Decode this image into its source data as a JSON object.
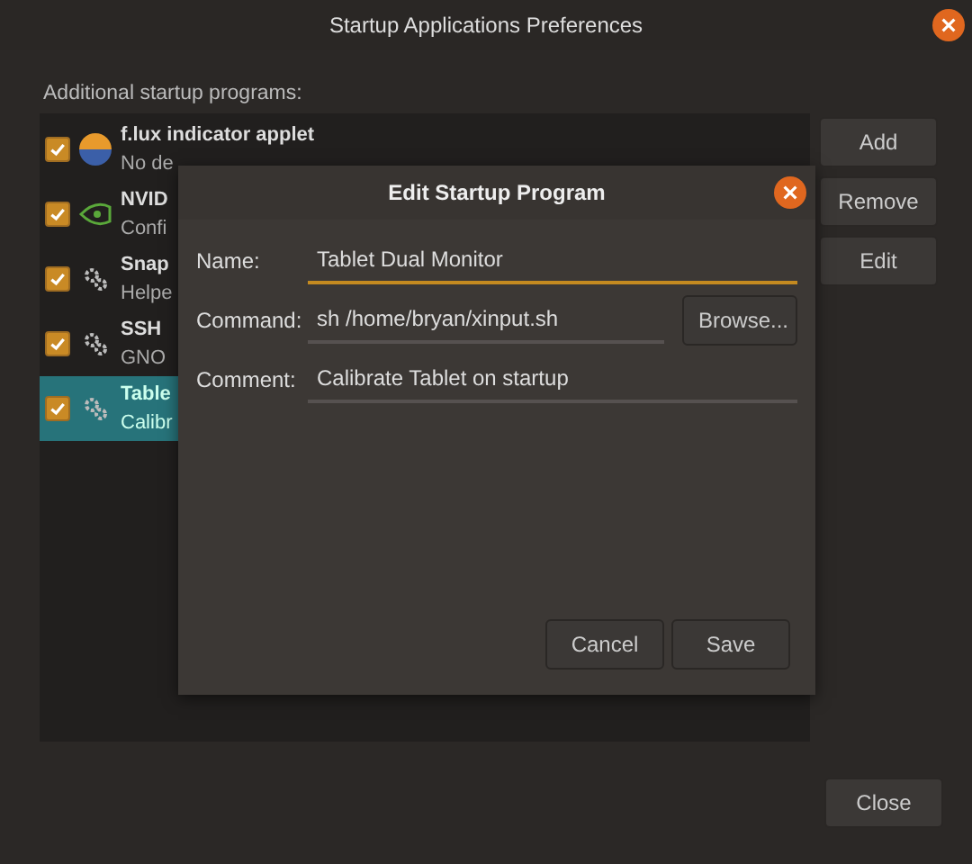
{
  "window": {
    "title": "Startup Applications Preferences"
  },
  "list_label": "Additional startup programs:",
  "programs": [
    {
      "name": "f.lux indicator applet",
      "comment": "No de",
      "kind": "sphere",
      "checked": true,
      "selected": false
    },
    {
      "name": "NVID",
      "comment": "Confi",
      "kind": "chip",
      "checked": true,
      "selected": false
    },
    {
      "name": "Snap",
      "comment": "Helpe",
      "kind": "gear",
      "checked": true,
      "selected": false
    },
    {
      "name": "SSH",
      "comment": "GNO",
      "kind": "gear",
      "checked": true,
      "selected": false
    },
    {
      "name": "Table",
      "comment": "Calibr",
      "kind": "gear",
      "checked": true,
      "selected": true
    }
  ],
  "side_buttons": [
    "Add",
    "Remove",
    "Edit"
  ],
  "close_button": "Close",
  "dialog": {
    "title": "Edit Startup Program",
    "fields": [
      {
        "label": "Name:",
        "value": "Tablet Dual Monitor",
        "focused": true
      },
      {
        "label": "Command:",
        "value": "sh /home/bryan/xinput.sh",
        "focused": false,
        "button": "Browse..."
      },
      {
        "label": "Comment:",
        "value": "Calibrate Tablet on startup",
        "focused": false
      }
    ],
    "buttons": [
      "Cancel",
      "Save"
    ]
  }
}
